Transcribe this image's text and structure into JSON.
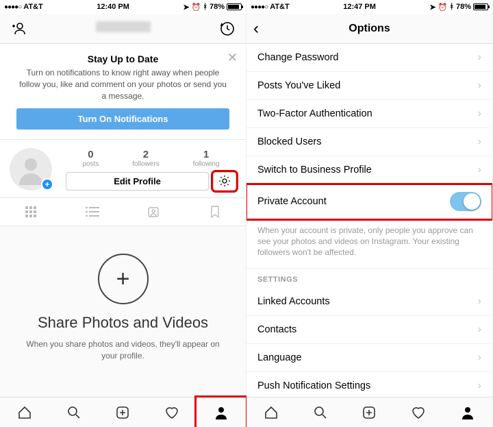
{
  "left": {
    "status": {
      "carrier": "AT&T",
      "time": "12:40 PM",
      "battery": "78%"
    },
    "card": {
      "title": "Stay Up to Date",
      "body": "Turn on notifications to know right away when people follow you, like and comment on your photos or send you a message.",
      "button": "Turn On Notifications"
    },
    "stats": {
      "posts": {
        "n": "0",
        "l": "posts"
      },
      "followers": {
        "n": "2",
        "l": "followers"
      },
      "following": {
        "n": "1",
        "l": "following"
      }
    },
    "edit": "Edit Profile",
    "empty": {
      "title": "Share Photos and Videos",
      "body": "When you share photos and videos, they'll appear on your profile."
    }
  },
  "right": {
    "status": {
      "carrier": "AT&T",
      "time": "12:47 PM",
      "battery": "78%"
    },
    "title": "Options",
    "rows": {
      "r0": "Change Password",
      "r1": "Posts You've Liked",
      "r2": "Two-Factor Authentication",
      "r3": "Blocked Users",
      "r4": "Switch to Business Profile",
      "r5": "Private Account",
      "note": "When your account is private, only people you approve can see your photos and videos on Instagram. Your existing followers won't be affected.",
      "section": "SETTINGS",
      "r6": "Linked Accounts",
      "r7": "Contacts",
      "r8": "Language",
      "r9": "Push Notification Settings"
    }
  }
}
